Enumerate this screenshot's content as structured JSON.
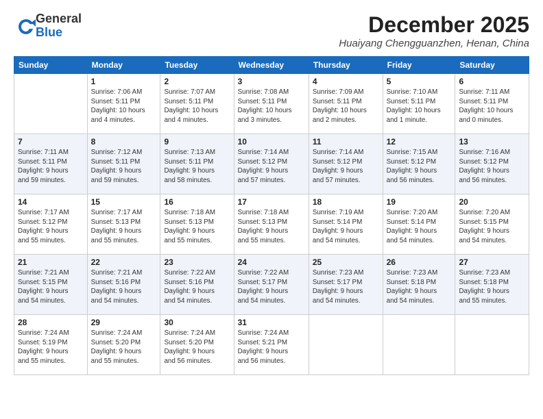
{
  "logo": {
    "line1": "General",
    "line2": "Blue"
  },
  "title": "December 2025",
  "subtitle": "Huaiyang Chengguanzhen, Henan, China",
  "days_of_week": [
    "Sunday",
    "Monday",
    "Tuesday",
    "Wednesday",
    "Thursday",
    "Friday",
    "Saturday"
  ],
  "weeks": [
    [
      {
        "day": "",
        "info": ""
      },
      {
        "day": "1",
        "info": "Sunrise: 7:06 AM\nSunset: 5:11 PM\nDaylight: 10 hours\nand 4 minutes."
      },
      {
        "day": "2",
        "info": "Sunrise: 7:07 AM\nSunset: 5:11 PM\nDaylight: 10 hours\nand 4 minutes."
      },
      {
        "day": "3",
        "info": "Sunrise: 7:08 AM\nSunset: 5:11 PM\nDaylight: 10 hours\nand 3 minutes."
      },
      {
        "day": "4",
        "info": "Sunrise: 7:09 AM\nSunset: 5:11 PM\nDaylight: 10 hours\nand 2 minutes."
      },
      {
        "day": "5",
        "info": "Sunrise: 7:10 AM\nSunset: 5:11 PM\nDaylight: 10 hours\nand 1 minute."
      },
      {
        "day": "6",
        "info": "Sunrise: 7:11 AM\nSunset: 5:11 PM\nDaylight: 10 hours\nand 0 minutes."
      }
    ],
    [
      {
        "day": "7",
        "info": "Sunrise: 7:11 AM\nSunset: 5:11 PM\nDaylight: 9 hours\nand 59 minutes."
      },
      {
        "day": "8",
        "info": "Sunrise: 7:12 AM\nSunset: 5:11 PM\nDaylight: 9 hours\nand 59 minutes."
      },
      {
        "day": "9",
        "info": "Sunrise: 7:13 AM\nSunset: 5:11 PM\nDaylight: 9 hours\nand 58 minutes."
      },
      {
        "day": "10",
        "info": "Sunrise: 7:14 AM\nSunset: 5:12 PM\nDaylight: 9 hours\nand 57 minutes."
      },
      {
        "day": "11",
        "info": "Sunrise: 7:14 AM\nSunset: 5:12 PM\nDaylight: 9 hours\nand 57 minutes."
      },
      {
        "day": "12",
        "info": "Sunrise: 7:15 AM\nSunset: 5:12 PM\nDaylight: 9 hours\nand 56 minutes."
      },
      {
        "day": "13",
        "info": "Sunrise: 7:16 AM\nSunset: 5:12 PM\nDaylight: 9 hours\nand 56 minutes."
      }
    ],
    [
      {
        "day": "14",
        "info": "Sunrise: 7:17 AM\nSunset: 5:12 PM\nDaylight: 9 hours\nand 55 minutes."
      },
      {
        "day": "15",
        "info": "Sunrise: 7:17 AM\nSunset: 5:13 PM\nDaylight: 9 hours\nand 55 minutes."
      },
      {
        "day": "16",
        "info": "Sunrise: 7:18 AM\nSunset: 5:13 PM\nDaylight: 9 hours\nand 55 minutes."
      },
      {
        "day": "17",
        "info": "Sunrise: 7:18 AM\nSunset: 5:13 PM\nDaylight: 9 hours\nand 55 minutes."
      },
      {
        "day": "18",
        "info": "Sunrise: 7:19 AM\nSunset: 5:14 PM\nDaylight: 9 hours\nand 54 minutes."
      },
      {
        "day": "19",
        "info": "Sunrise: 7:20 AM\nSunset: 5:14 PM\nDaylight: 9 hours\nand 54 minutes."
      },
      {
        "day": "20",
        "info": "Sunrise: 7:20 AM\nSunset: 5:15 PM\nDaylight: 9 hours\nand 54 minutes."
      }
    ],
    [
      {
        "day": "21",
        "info": "Sunrise: 7:21 AM\nSunset: 5:15 PM\nDaylight: 9 hours\nand 54 minutes."
      },
      {
        "day": "22",
        "info": "Sunrise: 7:21 AM\nSunset: 5:16 PM\nDaylight: 9 hours\nand 54 minutes."
      },
      {
        "day": "23",
        "info": "Sunrise: 7:22 AM\nSunset: 5:16 PM\nDaylight: 9 hours\nand 54 minutes."
      },
      {
        "day": "24",
        "info": "Sunrise: 7:22 AM\nSunset: 5:17 PM\nDaylight: 9 hours\nand 54 minutes."
      },
      {
        "day": "25",
        "info": "Sunrise: 7:23 AM\nSunset: 5:17 PM\nDaylight: 9 hours\nand 54 minutes."
      },
      {
        "day": "26",
        "info": "Sunrise: 7:23 AM\nSunset: 5:18 PM\nDaylight: 9 hours\nand 54 minutes."
      },
      {
        "day": "27",
        "info": "Sunrise: 7:23 AM\nSunset: 5:18 PM\nDaylight: 9 hours\nand 55 minutes."
      }
    ],
    [
      {
        "day": "28",
        "info": "Sunrise: 7:24 AM\nSunset: 5:19 PM\nDaylight: 9 hours\nand 55 minutes."
      },
      {
        "day": "29",
        "info": "Sunrise: 7:24 AM\nSunset: 5:20 PM\nDaylight: 9 hours\nand 55 minutes."
      },
      {
        "day": "30",
        "info": "Sunrise: 7:24 AM\nSunset: 5:20 PM\nDaylight: 9 hours\nand 56 minutes."
      },
      {
        "day": "31",
        "info": "Sunrise: 7:24 AM\nSunset: 5:21 PM\nDaylight: 9 hours\nand 56 minutes."
      },
      {
        "day": "",
        "info": ""
      },
      {
        "day": "",
        "info": ""
      },
      {
        "day": "",
        "info": ""
      }
    ]
  ]
}
